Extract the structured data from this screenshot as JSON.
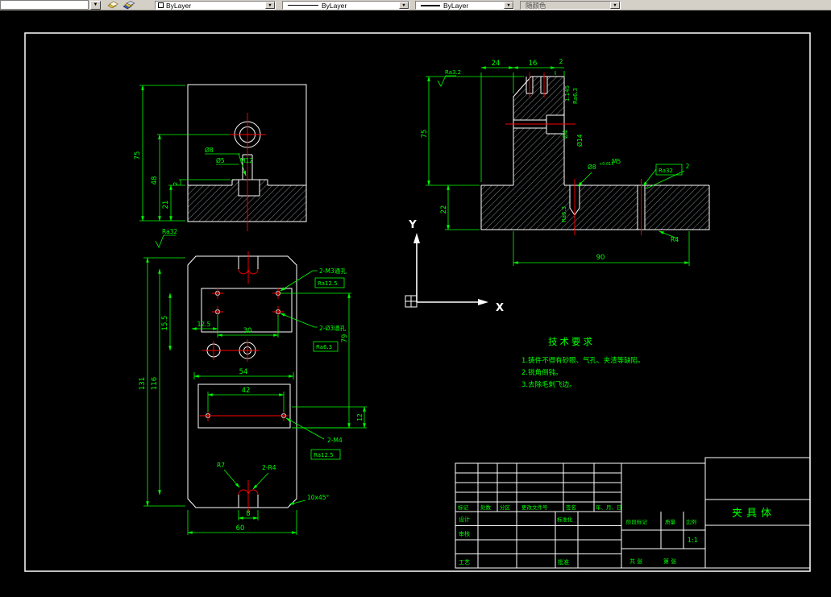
{
  "toolbar": {
    "color": "ByLayer",
    "linetype": "ByLayer",
    "lineweight": "ByLayer",
    "plotstyle": "随颜色"
  },
  "ucs": {
    "x": "X",
    "y": "Y"
  },
  "tech": {
    "title": "技术要求",
    "i1": "1.铸件不得有砂眼、气孔、夹渣等缺陷。",
    "i2": "2.锐角倒钝。",
    "i3": "3.去除毛刺飞边。"
  },
  "fv": {
    "d75": "75",
    "d48": "48",
    "d21": "21",
    "d2": "2",
    "dia8": "Ø8",
    "dia5": "Ø5",
    "m12": "M12",
    "ra32": "Ra32"
  },
  "pv": {
    "d131": "131",
    "d116": "116",
    "d155": "15.5",
    "d125": "12.5",
    "d30": "30",
    "d54": "54",
    "d42": "42",
    "d12": "12",
    "d79": "79",
    "d8": "8",
    "d60": "60",
    "m3": "2-M3通孔",
    "ra125a": "Ra12.5",
    "dia3": "2-Ø3通孔",
    "ra63": "Ra6.3",
    "m4": "2-M4",
    "ra125b": "Ra12.5",
    "r7": "R7",
    "r4": "2-R4",
    "chamfer": "10x45°"
  },
  "sv": {
    "d24": "24",
    "d16": "16",
    "d2a": "2",
    "ra32top": "Ra3.2",
    "d75": "75",
    "d22": "22",
    "d90": "90",
    "dia4": "Ø4",
    "dia14": "Ø14",
    "n1145": "1.145",
    "ra63a": "Ra6.3",
    "dia8": "Ø8",
    "tol": "+0.015",
    "m5": "M5",
    "ra32box": "Ra32",
    "d2b": "2",
    "r4": "R4",
    "ra63b": "Ra6.3"
  },
  "tb": {
    "mark": "标记",
    "count": "处数",
    "zone": "分区",
    "doc": "更改文件号",
    "sign": "签名",
    "date": "年、月、日",
    "design": "设计",
    "standard": "标准化",
    "check": "审核",
    "craft": "工艺",
    "approve": "批准",
    "stage": "阶段标记",
    "weight": "质量",
    "scale_lbl": "比例",
    "scale": "1:1",
    "sheets": "共 张",
    "sheetno": "第 张",
    "part": "夹具体"
  }
}
